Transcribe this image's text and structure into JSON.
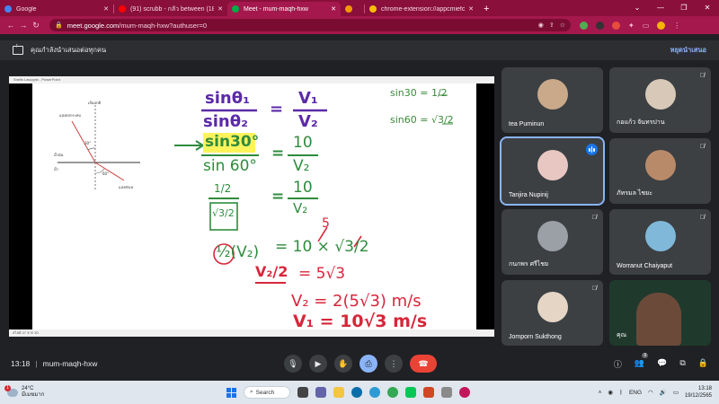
{
  "browser": {
    "tabs": [
      {
        "title": "Google",
        "favicon_color": "#4285f4",
        "active": false
      },
      {
        "title": "(91) scrubb - กลัว between (18th",
        "favicon_color": "#ff0000",
        "active": false
      },
      {
        "title": "Meet - mum-maqh-hxw",
        "favicon_color": "#00ac47",
        "active": true
      },
      {
        "title": "",
        "favicon_color": "#f29900",
        "active": false
      },
      {
        "title": "chrome-extension://appcmiefcd",
        "favicon_color": "#fbbc04",
        "active": false
      }
    ],
    "new_tab": "+",
    "url_host": "meet.google.com",
    "url_path": "/mum-maqh-hxw?authuser=0"
  },
  "banner": {
    "text": "คุณกำลังนำเสนอต่อทุกคน",
    "stop_label": "หยุดนำเสนอ"
  },
  "presentation": {
    "window_title": "Snells Law.pptx - PowerPoint",
    "status_text": "สไลด์ 27 จาก 30",
    "diagram_labels": [
      "เส้นปกติ",
      "แสงตกกระทบ",
      "น้ำมัน",
      "น้ำ",
      "แสงหักเห",
      "30°",
      "60°"
    ],
    "handwriting": {
      "top_right_1": "sin30 = 1/2",
      "top_right_2": "sin60 = √3/2",
      "eq1_num": "sinθ₁",
      "eq1_den": "sinθ₂",
      "eq1_eq": "=",
      "eq1_rhs_num": "V₁",
      "eq1_rhs_den": "V₂",
      "eq2_num": "sin30°",
      "eq2_den": "sin 60°",
      "eq2_rhs_num": "10",
      "eq2_rhs_den": "V₂",
      "eq3_num": "1/2",
      "eq3_den": "√3/2",
      "eq3_rhs_num": "10",
      "eq3_rhs_den": "V₂",
      "eq4_lhs": "½(V₂)",
      "eq4_rhs": "= 10 × √3/2",
      "eq4_five": "5",
      "eq5_lhs": "V₂/2",
      "eq5_rhs": "= 5√3",
      "eq6": "V₂ = 2(5√3) m/s",
      "eq7": "V₁ = 10√3 m/s"
    }
  },
  "participants": [
    {
      "name": "tea Puminun",
      "muted": false,
      "avatar_color": "#c9a98a",
      "speaking": false
    },
    {
      "name": "กอแก้ว จันทรปาน",
      "muted": true,
      "avatar_color": "#d7c8b8",
      "speaking": false
    },
    {
      "name": "Tanjira Nupinij",
      "muted": false,
      "avatar_color": "#e8c7c2",
      "speaking": true
    },
    {
      "name": "ภัทรมล ไชยะ",
      "muted": true,
      "avatar_color": "#b88a6a",
      "speaking": false
    },
    {
      "name": "กนกพร ศรีไชย",
      "muted": true,
      "avatar_color": "#9aa0a6",
      "speaking": false
    },
    {
      "name": "Worranut Chaiyaput",
      "muted": true,
      "avatar_color": "#7fb8d9",
      "speaking": false
    },
    {
      "name": "Jomporn Sukthong",
      "muted": true,
      "avatar_color": "#e5d5c5",
      "speaking": false
    },
    {
      "name": "คุณ",
      "muted": false,
      "avatar_color": "#6b4a3a",
      "speaking": false
    }
  ],
  "meeting": {
    "time": "13:18",
    "code": "mum-maqh-hxw",
    "people_count": "9"
  },
  "taskbar": {
    "weather_badge": "1",
    "temperature": "24°C",
    "weather_desc": "มีเมฆมาก",
    "search_label": "Search",
    "language": "ENG",
    "clock_time": "13:18",
    "clock_date": "19/12/2565"
  }
}
